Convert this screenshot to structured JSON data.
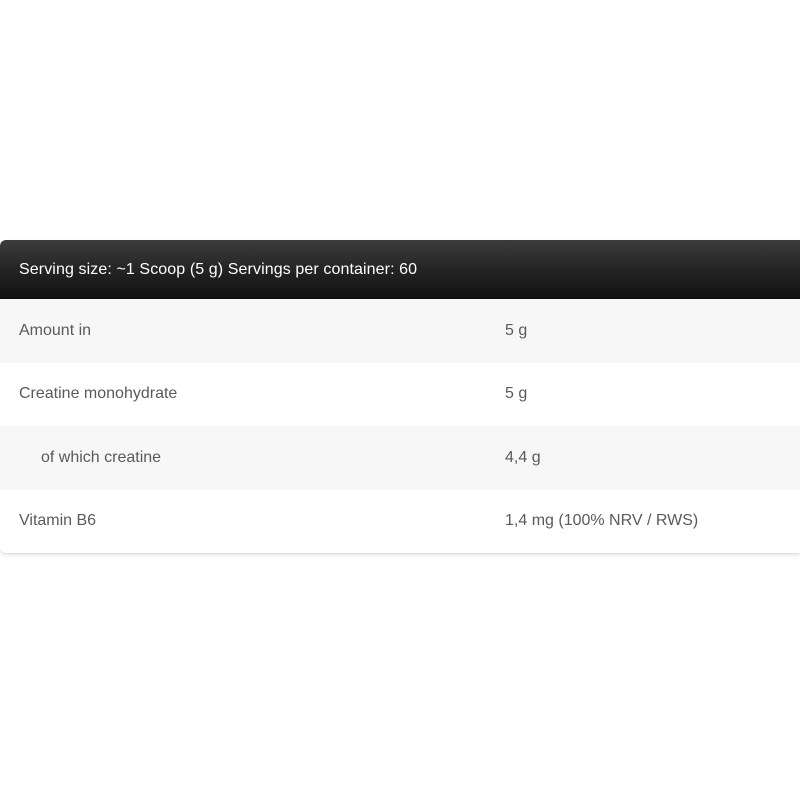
{
  "table": {
    "header": "Serving size: ~1 Scoop (5 g) Servings per container: 60",
    "rows": [
      {
        "name": "Amount in",
        "value": "5 g"
      },
      {
        "name": "Creatine monohydrate",
        "value": "5 g"
      },
      {
        "name": "of which creatine",
        "value": "4,4 g"
      },
      {
        "name": "Vitamin B6",
        "value": "1,4 mg (100% NRV / RWS)"
      }
    ]
  },
  "colors": {
    "header_bg": "#222222",
    "header_text": "#ffffff",
    "row_alt_bg": "#f7f7f7",
    "row_text": "#5a5a5a"
  }
}
